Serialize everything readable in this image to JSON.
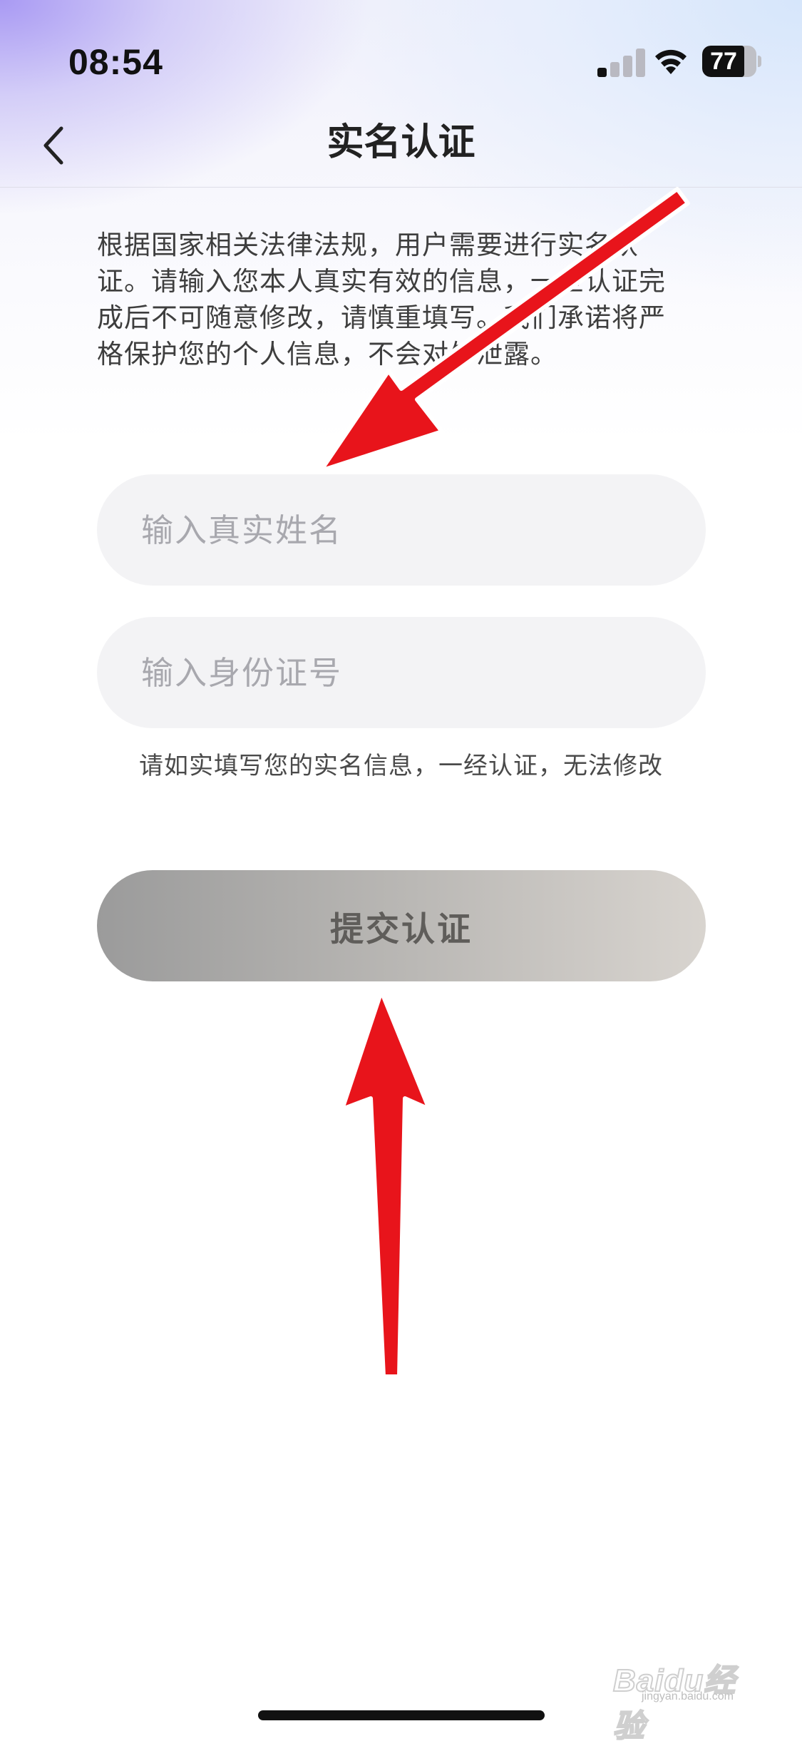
{
  "status_bar": {
    "time": "08:54",
    "battery_level": "77",
    "battery_fraction": 0.77,
    "signal_bars_active": 1,
    "signal_icon": "cellular-signal-icon",
    "wifi_icon": "wifi-icon",
    "battery_icon": "battery-icon"
  },
  "nav": {
    "back_icon": "chevron-left-icon",
    "title": "实名认证"
  },
  "intro": {
    "text": "根据国家相关法律法规，用户需要进行实名认证。请输入您本人真实有效的信息，一旦认证完成后不可随意修改，请慎重填写。我们承诺将严格保护您的个人信息，不会对外泄露。"
  },
  "form": {
    "name_placeholder": "输入真实姓名",
    "name_value": "",
    "id_placeholder": "输入身份证号",
    "id_value": "",
    "hint": "请如实填写您的实名信息，一经认证，无法修改",
    "submit_label": "提交认证"
  },
  "annotations": {
    "arrow_color": "#e8141b",
    "arrow_icon": "red-arrow-icon"
  },
  "watermark": {
    "mark": "Baidu经验",
    "sub": "jingyan.baidu.com"
  },
  "colors": {
    "input_bg": "#f3f3f5",
    "placeholder": "#a8a8ae",
    "button_gradient_start": "#9b9b9b",
    "button_gradient_end": "#d8d4cf",
    "header_gradient_left": "#a99af3",
    "header_gradient_right": "#d6e6fb"
  }
}
